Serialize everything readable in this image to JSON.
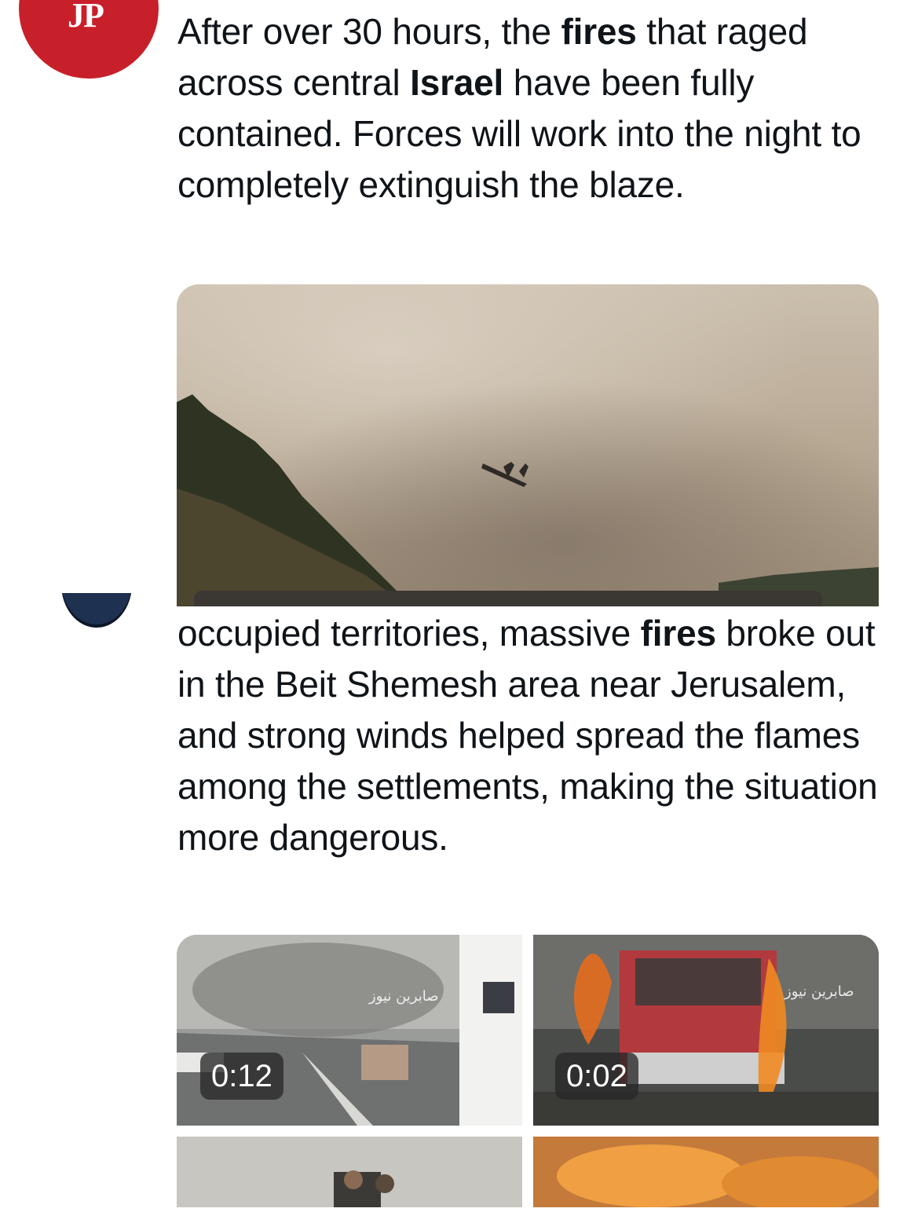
{
  "tweet1": {
    "avatar_letters": "JP",
    "text_segments": [
      {
        "text": "After over 30 hours, the ",
        "bold": false
      },
      {
        "text": "fires",
        "bold": true
      },
      {
        "text": " that raged across central ",
        "bold": false
      },
      {
        "text": "Israel",
        "bold": true
      },
      {
        "text": " have been fully contained. Forces will work into the night to completely extinguish the blaze.",
        "bold": false
      }
    ]
  },
  "tweet2": {
    "text_segments": [
      {
        "text": "occupied territories, massive ",
        "bold": false
      },
      {
        "text": "fires",
        "bold": true
      },
      {
        "text": " broke out in the Beit Shemesh area near Jerusalem, and strong winds helped spread the flames among the settlements, making the situation more dangerous.",
        "bold": false
      }
    ],
    "media": [
      {
        "duration": "0:12",
        "watermark": "صابرين نيوز"
      },
      {
        "duration": "0:02",
        "watermark": "صابرين نيوز"
      }
    ]
  },
  "colors": {
    "jp_red": "#c8202a",
    "text": "#0f1419",
    "duration_badge_bg": "#282828"
  }
}
